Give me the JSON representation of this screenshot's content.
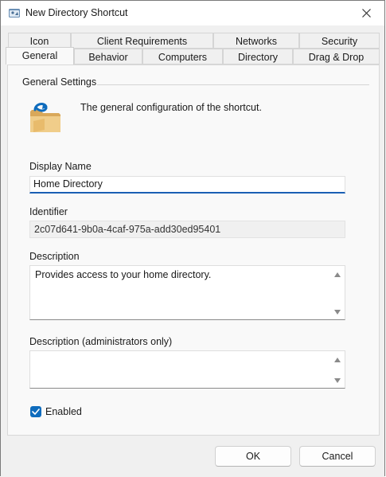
{
  "window": {
    "title": "New Directory Shortcut"
  },
  "tabs": {
    "row1": [
      "Icon",
      "Client Requirements",
      "Networks",
      "Security"
    ],
    "row2": [
      "General",
      "Behavior",
      "Computers",
      "Directory",
      "Drag & Drop"
    ],
    "selected": "General"
  },
  "general": {
    "group_title": "General Settings",
    "description_text": "The general configuration of the shortcut.",
    "display_name_label": "Display Name",
    "display_name_value": "Home Directory",
    "identifier_label": "Identifier",
    "identifier_value": "2c07d641-9b0a-4caf-975a-add30ed95401",
    "description_label": "Description",
    "description_value": "Provides access to your home directory.",
    "admin_description_label": "Description (administrators only)",
    "admin_description_value": "",
    "enabled_label": "Enabled",
    "enabled": true
  },
  "buttons": {
    "ok": "OK",
    "cancel": "Cancel"
  },
  "colors": {
    "accent": "#0f6cbd",
    "folder": "#e8c07a"
  }
}
